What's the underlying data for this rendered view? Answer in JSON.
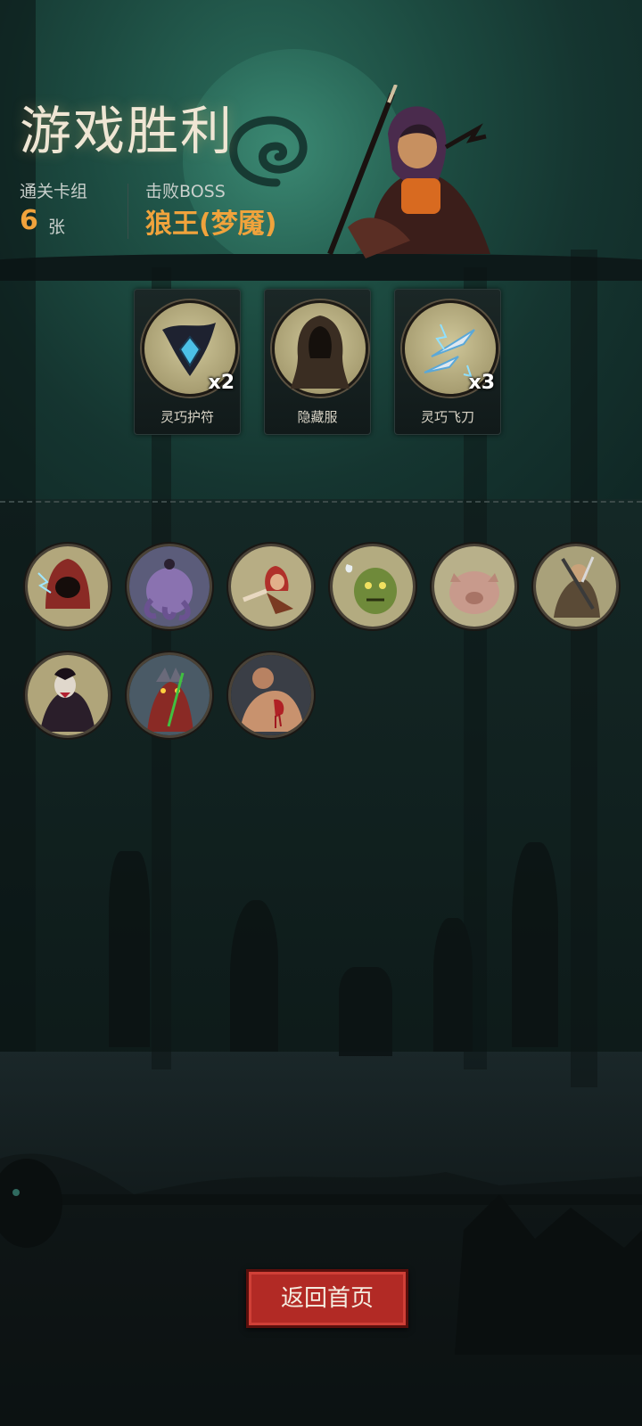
{
  "result": {
    "title": "游戏胜利",
    "deck_label": "通关卡组",
    "deck_count": "6",
    "deck_unit": "张",
    "boss_label": "击败BOSS",
    "boss_name": "狼王(梦魇)"
  },
  "rewards": [
    {
      "name": "灵巧护符",
      "qty": "x2",
      "icon": "amulet-icon"
    },
    {
      "name": "隐藏服",
      "qty": "",
      "icon": "hood-cloak-icon"
    },
    {
      "name": "灵巧飞刀",
      "qty": "x3",
      "icon": "throwing-knife-icon"
    }
  ],
  "defeated_enemies": [
    {
      "icon": "hooded-mage-portrait"
    },
    {
      "icon": "tentacle-beast-portrait"
    },
    {
      "icon": "red-hood-portrait"
    },
    {
      "icon": "green-ghoul-portrait"
    },
    {
      "icon": "pig-beast-portrait"
    },
    {
      "icon": "armored-warrior-portrait"
    },
    {
      "icon": "vampire-portrait"
    },
    {
      "icon": "red-wolf-portrait"
    },
    {
      "icon": "brute-portrait"
    }
  ],
  "actions": {
    "home_label": "返回首页"
  },
  "colors": {
    "accent": "#f0a33c",
    "button": "#b22a25"
  }
}
